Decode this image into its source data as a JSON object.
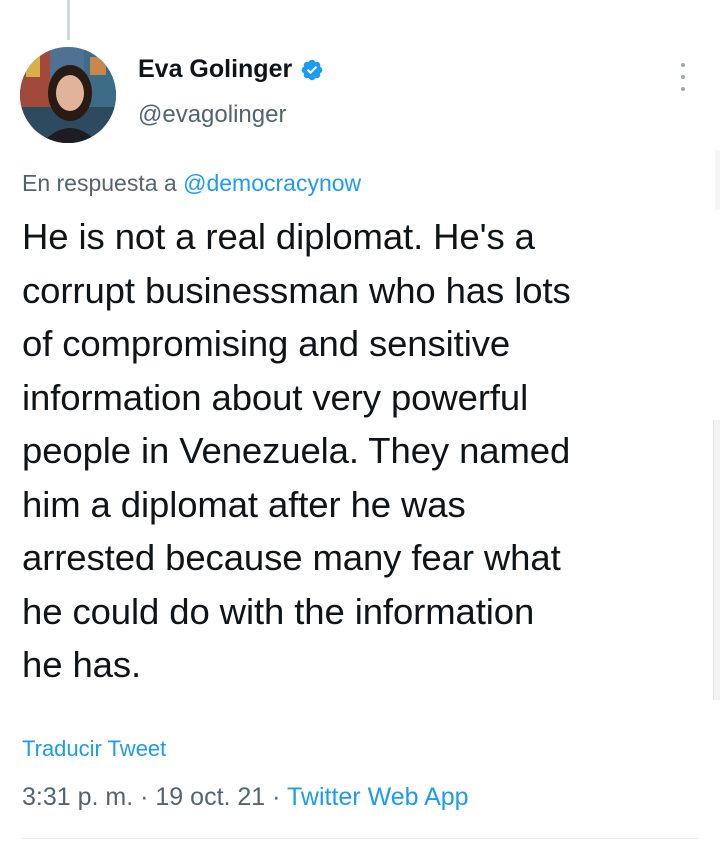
{
  "tweet": {
    "author": {
      "display_name": "Eva Golinger",
      "handle": "@evagolinger",
      "verified": true,
      "avatar_icon": "profile-photo"
    },
    "reply_to": {
      "prefix": "En respuesta a",
      "handle": "@democracynow"
    },
    "text": "He is not a real diplomat. He's a\ncorrupt businessman who has lots\nof compromising and sensitive\ninformation about very powerful\npeople in Venezuela. They named\nhim a diplomat after he was\narrested because many fear what\nhe could do with the information\nhe has.",
    "translate_label": "Traducir Tweet",
    "time": "3:31 p. m.",
    "separator": "·",
    "date": "19 oct. 21",
    "source": "Twitter Web App"
  },
  "colors": {
    "accent": "#1d9bf0",
    "secondary_text": "#536471",
    "primary_text": "#0f1419"
  },
  "icons": {
    "verified": "verified-badge-icon",
    "more": "more-options-icon"
  }
}
